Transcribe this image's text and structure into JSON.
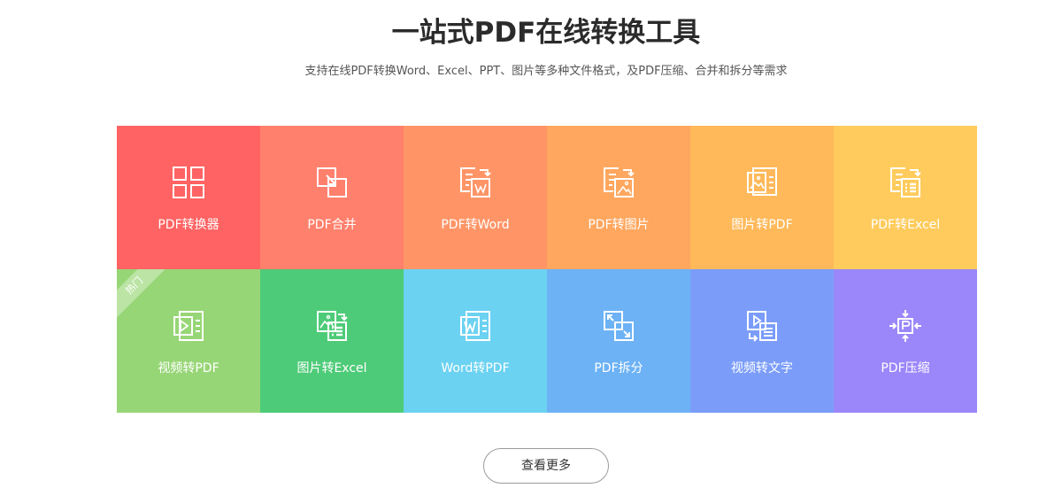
{
  "header": {
    "title": "一站式PDF在线转换工具",
    "subtitle": "支持在线PDF转换Word、Excel、PPT、图片等多种文件格式，及PDF压缩、合并和拆分等需求"
  },
  "tools": [
    {
      "label": "PDF转换器",
      "color": "#ff6363",
      "icon": "grid-icon"
    },
    {
      "label": "PDF合并",
      "color": "#ff806c",
      "icon": "merge-icon"
    },
    {
      "label": "PDF转Word",
      "color": "#ff9567",
      "icon": "pdf-to-word-icon"
    },
    {
      "label": "PDF转图片",
      "color": "#ffa75f",
      "icon": "pdf-to-image-icon"
    },
    {
      "label": "图片转PDF",
      "color": "#ffb95a",
      "icon": "image-to-pdf-icon"
    },
    {
      "label": "PDF转Excel",
      "color": "#ffcb5c",
      "icon": "pdf-to-excel-icon"
    },
    {
      "label": "视频转PDF",
      "color": "#97d676",
      "icon": "video-to-pdf-icon",
      "badge": "热门"
    },
    {
      "label": "图片转Excel",
      "color": "#4ecb78",
      "icon": "image-to-excel-icon"
    },
    {
      "label": "Word转PDF",
      "color": "#6bd2f1",
      "icon": "word-to-pdf-icon"
    },
    {
      "label": "PDF拆分",
      "color": "#6db2f5",
      "icon": "split-icon"
    },
    {
      "label": "视频转文字",
      "color": "#7b9df9",
      "icon": "video-to-text-icon"
    },
    {
      "label": "PDF压缩",
      "color": "#9b87fa",
      "icon": "compress-icon"
    }
  ],
  "more_button": {
    "label": "查看更多"
  }
}
